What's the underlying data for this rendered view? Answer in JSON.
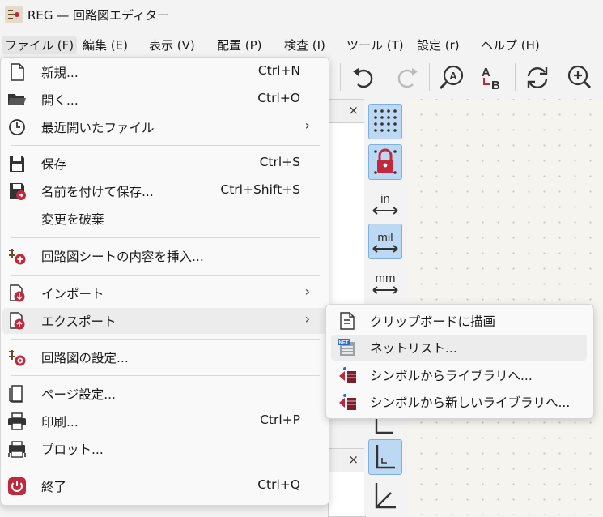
{
  "window": {
    "title": "REG — 回路図エディター"
  },
  "menubar": {
    "items": [
      {
        "label": "ファイル (F)"
      },
      {
        "label": "編集 (E)"
      },
      {
        "label": "表示 (V)"
      },
      {
        "label": "配置 (P)"
      },
      {
        "label": "検査 (I)"
      },
      {
        "label": "ツール (T)"
      },
      {
        "label": "設定 (r)"
      },
      {
        "label": "ヘルプ (H)"
      }
    ]
  },
  "file_menu": {
    "items": [
      {
        "label": "新規...",
        "shortcut": "Ctrl+N",
        "icon": "new-file-icon"
      },
      {
        "label": "開く...",
        "shortcut": "Ctrl+O",
        "icon": "folder-open-icon"
      },
      {
        "label": "最近開いたファイル",
        "submenu": true,
        "icon": "clock-icon"
      },
      {
        "label": "保存",
        "shortcut": "Ctrl+S",
        "icon": "save-icon"
      },
      {
        "label": "名前を付けて保存...",
        "shortcut": "Ctrl+Shift+S",
        "icon": "save-as-icon"
      },
      {
        "label": "変更を破棄"
      },
      {
        "label": "回路図シートの内容を挿入...",
        "icon": "insert-sheet-icon"
      },
      {
        "label": "インポート",
        "submenu": true,
        "icon": "import-icon"
      },
      {
        "label": "エクスポート",
        "submenu": true,
        "icon": "export-icon"
      },
      {
        "label": "回路図の設定...",
        "icon": "schematic-settings-icon"
      },
      {
        "label": "ページ設定...",
        "icon": "page-setup-icon"
      },
      {
        "label": "印刷...",
        "shortcut": "Ctrl+P",
        "icon": "print-icon"
      },
      {
        "label": "プロット...",
        "icon": "plot-icon"
      },
      {
        "label": "終了",
        "shortcut": "Ctrl+Q",
        "icon": "quit-icon"
      }
    ],
    "submenu_arrow": "›"
  },
  "export_submenu": {
    "items": [
      {
        "label": "クリップボードに描画",
        "icon": "clipboard-icon"
      },
      {
        "label": "ネットリスト...",
        "icon": "netlist-icon",
        "badge": "NET"
      },
      {
        "label": "シンボルからライブラリへ...",
        "icon": "symbol-library-icon"
      },
      {
        "label": "シンボルから新しいライブラリへ...",
        "icon": "symbol-new-library-icon"
      }
    ]
  },
  "left_toolbar": {
    "items": [
      {
        "icon": "grid-icon",
        "active": true
      },
      {
        "icon": "grid-lock-icon",
        "active": true
      },
      {
        "label": "in",
        "icon": "units-inch-icon",
        "active": false
      },
      {
        "label": "mil",
        "icon": "units-mil-icon",
        "active": true
      },
      {
        "label": "mm",
        "icon": "units-mm-icon",
        "active": false
      }
    ]
  },
  "panel": {
    "close": "×"
  },
  "colors": {
    "accent": "#bcd8f3",
    "highlight": "#ececec",
    "icon_red": "#c0283c"
  }
}
